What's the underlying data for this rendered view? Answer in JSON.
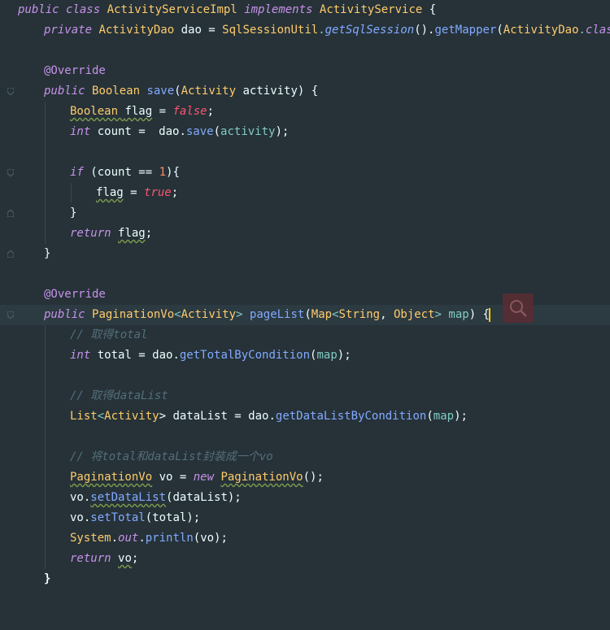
{
  "editor": {
    "colors": {
      "background": "#263238",
      "current_line": "#2c3a41",
      "keyword": "#C792EA",
      "type": "#FFCB6B",
      "method": "#82AAFF",
      "comment": "#546E7A",
      "number": "#F78C6C",
      "boolean": "#FF5370"
    },
    "icons": [
      "fold-marker-icon",
      "lightbulb-icon",
      "search-icon"
    ]
  },
  "code": {
    "l1": [
      "public ",
      "class ",
      "ActivityServiceImpl ",
      "implements ",
      "ActivityService",
      " {"
    ],
    "l2": [
      "private ",
      "ActivityDao",
      " dao = ",
      "SqlSessionUtil",
      ".",
      "getSqlSession",
      "().",
      "getMapper",
      "(",
      "ActivityDao",
      ".",
      "class",
      ");"
    ],
    "l4": "@Override",
    "l5": [
      "public ",
      "Boolean ",
      "save",
      "(",
      "Activity",
      " activity) {"
    ],
    "l6": [
      "Boolean ",
      "flag",
      " = ",
      "false",
      ";"
    ],
    "l7": [
      "int ",
      "count = ",
      "dao.",
      "save",
      "(",
      "activity",
      ");"
    ],
    "l9": [
      "if ",
      "(count == ",
      "1",
      "){"
    ],
    "l10": [
      "flag",
      " = ",
      "true",
      ";"
    ],
    "l11": "}",
    "l12": [
      "return ",
      "flag",
      ";"
    ],
    "l13": "}",
    "l15": "@Override",
    "l16": [
      "public ",
      "PaginationVo",
      "<",
      "Activity",
      "> ",
      "pageList",
      "(",
      "Map",
      "<",
      "String",
      ", ",
      "Object",
      "> ",
      "map",
      ") {"
    ],
    "l17": "// 取得total",
    "l18": [
      "int ",
      "total = ",
      "dao.",
      "getTotalByCondition",
      "(",
      "map",
      ");"
    ],
    "l20": "// 取得dataList",
    "l21": [
      "List",
      "<",
      "Activity",
      "> dataList = ",
      "dao.",
      "getDataListByCondition",
      "(",
      "map",
      ");"
    ],
    "l23": "// 将total和dataList封装成一个vo",
    "l24": [
      "PaginationVo",
      " vo = ",
      "new ",
      "PaginationVo",
      "();"
    ],
    "l25": [
      "vo.",
      "setDataList",
      "(dataList);"
    ],
    "l26": [
      "vo.",
      "setTotal",
      "(total);"
    ],
    "l27": [
      "System",
      ".",
      "out",
      ".",
      "println",
      "(vo);"
    ],
    "l28": [
      "return ",
      "vo",
      ";"
    ],
    "l29": "}"
  }
}
